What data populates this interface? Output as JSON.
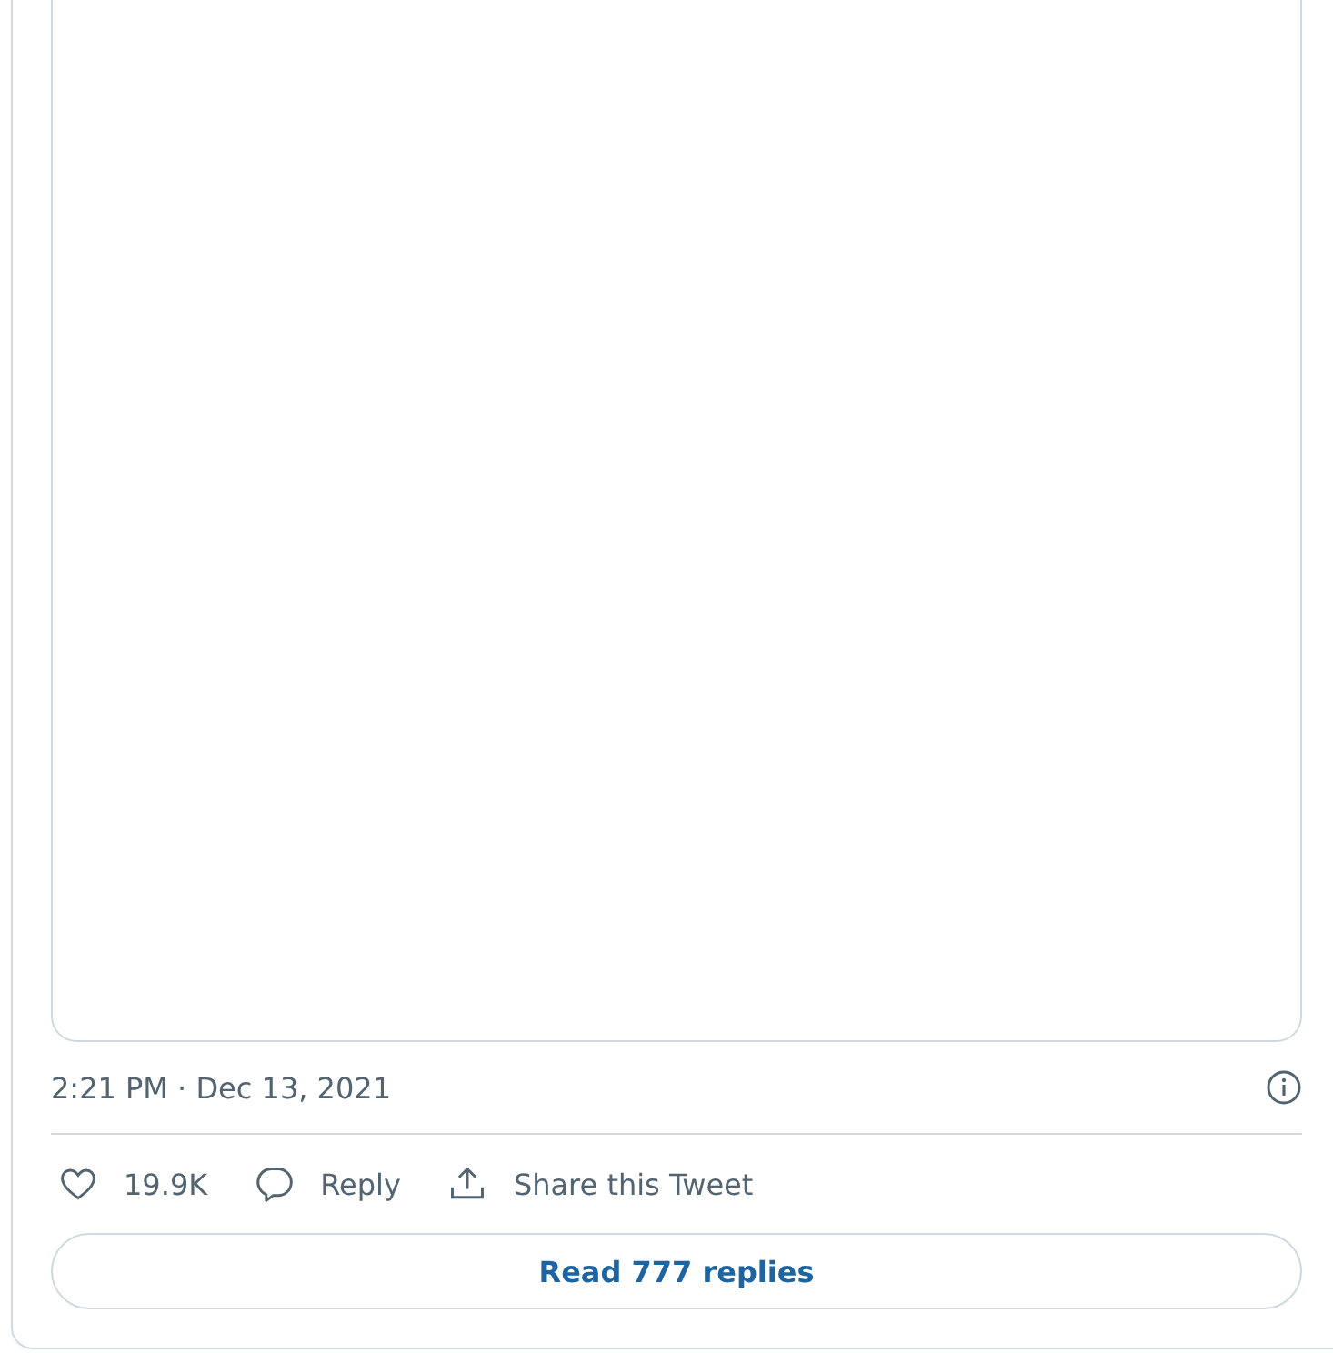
{
  "tweet": {
    "timestamp": "2:21 PM · Dec 13, 2021",
    "actions": [
      {
        "kind": "like",
        "label": "19.9K"
      },
      {
        "kind": "reply",
        "label": "Reply"
      },
      {
        "kind": "share",
        "label": "Share this Tweet"
      }
    ],
    "read_replies": "Read 777 replies"
  }
}
